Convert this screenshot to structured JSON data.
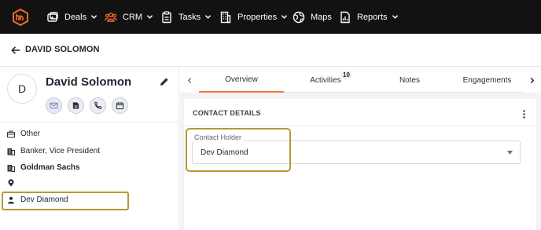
{
  "nav": {
    "items": [
      {
        "label": "Deals",
        "icon": "deals-icon"
      },
      {
        "label": "CRM",
        "icon": "crm-icon"
      },
      {
        "label": "Tasks",
        "icon": "tasks-icon"
      },
      {
        "label": "Properties",
        "icon": "properties-icon"
      },
      {
        "label": "Maps",
        "icon": "maps-icon"
      },
      {
        "label": "Reports",
        "icon": "reports-icon"
      }
    ],
    "accent": "#f26a2b"
  },
  "header": {
    "title": "DAVID SOLOMON"
  },
  "contact": {
    "initial": "D",
    "name": "David Solomon",
    "type": "Other",
    "job_title": "Banker, Vice President",
    "company": "Goldman Sachs",
    "address": "",
    "owner": "Dev Diamond"
  },
  "tabs": [
    {
      "label": "Overview",
      "active": true
    },
    {
      "label": "Activities",
      "badge": "10"
    },
    {
      "label": "Notes"
    },
    {
      "label": "Engagements"
    }
  ],
  "details": {
    "section_title": "CONTACT DETAILS",
    "field_label": "Contact Holder",
    "field_value": "Dev Diamond"
  },
  "colors": {
    "tab_active": "#f07a3b",
    "highlight": "#b39a35",
    "topbar": "#121212"
  }
}
